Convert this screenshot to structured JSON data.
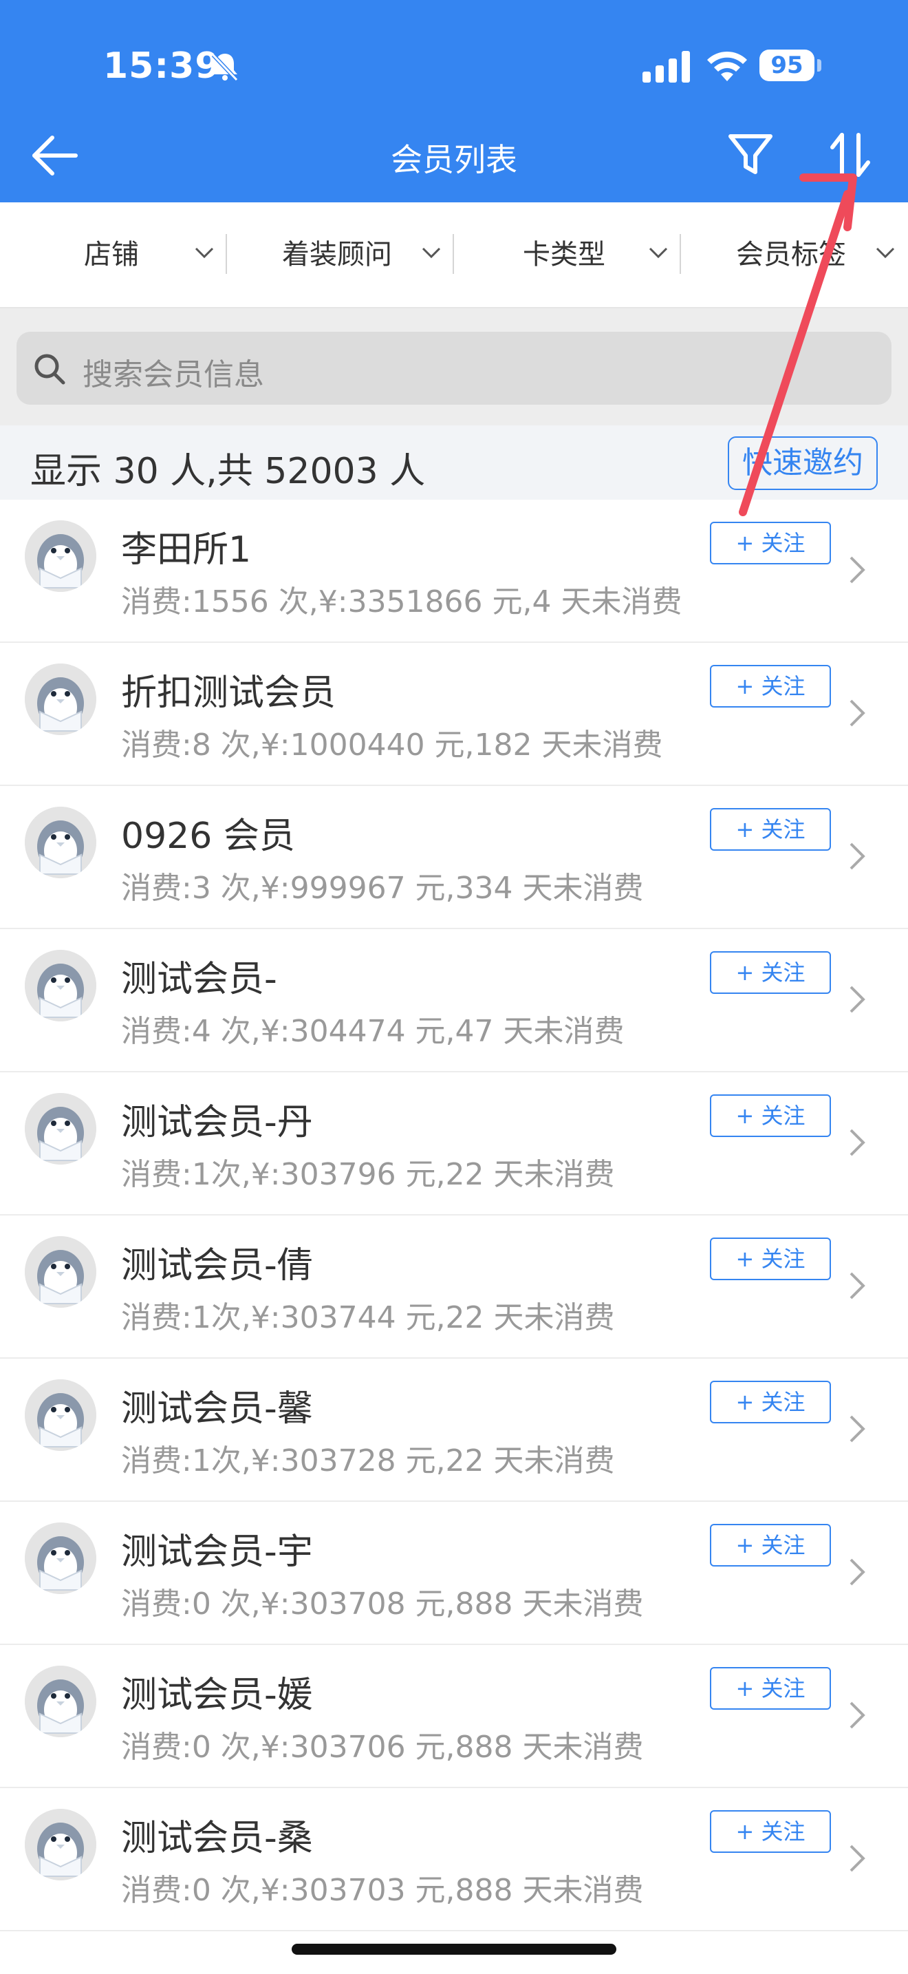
{
  "status_bar": {
    "time": "15:39",
    "battery": "95"
  },
  "header": {
    "title": "会员列表"
  },
  "filters": [
    {
      "label": "店铺"
    },
    {
      "label": "着装顾问"
    },
    {
      "label": "卡类型"
    },
    {
      "label": "会员标签"
    }
  ],
  "search": {
    "placeholder": "搜索会员信息"
  },
  "summary": {
    "text": "显示 30 人,共 52003 人",
    "invite_label": "快速邀约"
  },
  "follow_label": "+ 关注",
  "members": [
    {
      "name": "李田所1",
      "stats": "消费:1556 次,¥:3351866 元,4 天未消费"
    },
    {
      "name": "折扣测试会员",
      "stats": "消费:8 次,¥:1000440 元,182 天未消费"
    },
    {
      "name": "0926 会员",
      "stats": "消费:3 次,¥:999967 元,334 天未消费"
    },
    {
      "name": "测试会员-",
      "stats": "消费:4 次,¥:304474 元,47 天未消费"
    },
    {
      "name": "测试会员-丹",
      "stats": "消费:1次,¥:303796 元,22 天未消费"
    },
    {
      "name": "测试会员-倩",
      "stats": "消费:1次,¥:303744 元,22 天未消费"
    },
    {
      "name": "测试会员-馨",
      "stats": "消费:1次,¥:303728 元,22 天未消费"
    },
    {
      "name": "测试会员-宇",
      "stats": "消费:0 次,¥:303708 元,888 天未消费"
    },
    {
      "name": "测试会员-媛",
      "stats": "消费:0 次,¥:303706 元,888 天未消费"
    },
    {
      "name": "测试会员-桑",
      "stats": "消费:0 次,¥:303703 元,888 天未消费"
    }
  ],
  "colors": {
    "accent": "#3585f1",
    "annotation_arrow": "#ef4a5a"
  },
  "icons": [
    "back-arrow-icon",
    "filter-icon",
    "sort-icon",
    "search-icon",
    "chevron-down-icon",
    "chevron-right-icon",
    "penguin-avatar-icon"
  ]
}
